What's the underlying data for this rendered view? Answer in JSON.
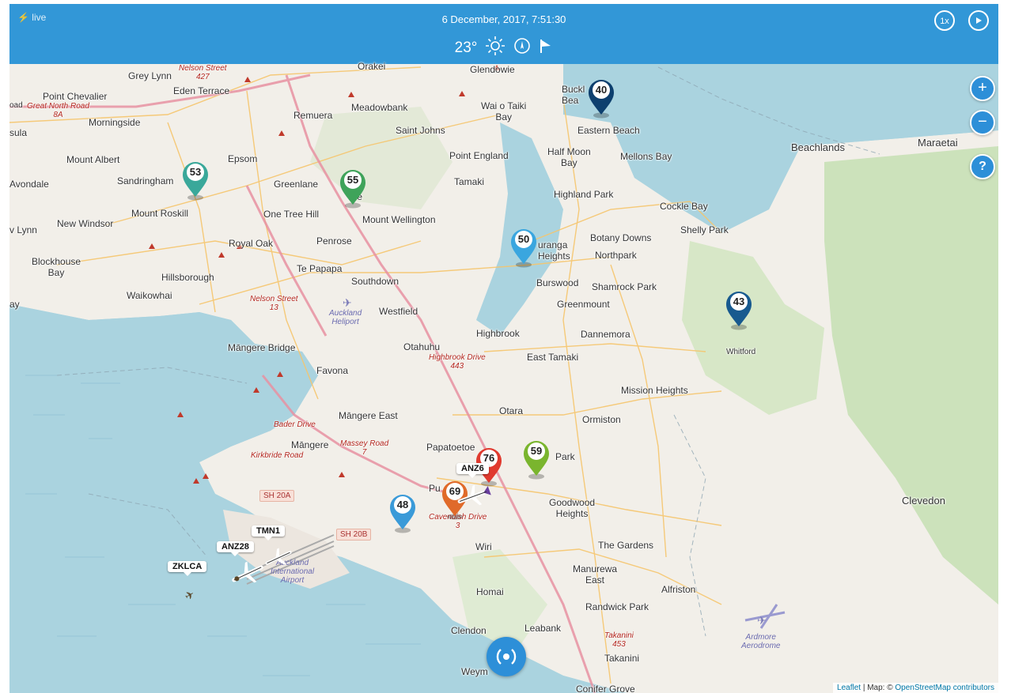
{
  "topbar": {
    "live": "⚡ live",
    "datetime": "6 December, 2017, 7:51:30",
    "temperature": "23°",
    "weather_icon": "sun-icon",
    "speed_label": "1x",
    "play_icon": "play-icon"
  },
  "zoom": {
    "in": "+",
    "out": "−",
    "help": "?"
  },
  "places": {
    "grey_lynn": "Grey Lynn",
    "eden_terrace": "Eden Terrace",
    "point_chevalier": "Point Chevalier",
    "morningside": "Morningside",
    "mount_albert": "Mount Albert",
    "avondale": "Avondale",
    "sandringham": "Sandringham",
    "epsom": "Epsom",
    "remuera": "Remuera",
    "meadowbank": "Meadowbank",
    "greenlane": "Greenlane",
    "ellerslie": "E         e",
    "mount_roskill": "Mount Roskill",
    "one_tree_hill": "One Tree Hill",
    "mount_wellington": "Mount Wellington",
    "new_windsor": "New Windsor",
    "lynn": "v Lynn",
    "royal_oak": "Royal Oak",
    "penrose": "Penrose",
    "blockhouse_bay": "Blockhouse\nBay",
    "te_papapa": "Te Papapa",
    "hillsborough": "Hillsborough",
    "southdown": "Southdown",
    "waikowhai": "Waikowhai",
    "westfield": "Westfield",
    "mangere_bridge": "Māngere Bridge",
    "otahuhu": "Otahuhu",
    "favona": "Favona",
    "mangere_east": "Māngere East",
    "mangere": "Māngere",
    "papatoetoe": "Papatoetoe",
    "pu": "Pu",
    "wiri": "Wiri",
    "homai": "Homai",
    "clendon": "Clendon",
    "leabank": "Leabank",
    "weymouth": "Weym",
    "takanini": "Takanini",
    "conifer_grove": "Conifer Grove",
    "manurewa_east": "Manurewa\nEast",
    "randwick_park": "Randwick Park",
    "alfriston": "Alfriston",
    "the_gardens": "The Gardens",
    "goodwood_heights": "Goodwood\nHeights",
    "park": "Park",
    "ormiston": "Ormiston",
    "otara": "Otara",
    "east_tamaki": "East Tamaki",
    "highbrook": "Highbrook",
    "dannemora": "Dannemora",
    "mission_heights": "Mission Heights",
    "greenmount": "Greenmount",
    "burswood": "Burswood",
    "shamrock_park": "Shamrock Park",
    "northpark": "Northpark",
    "botany_downs": "Botany Downs",
    "pakuranga_heights": "uranga\nHeights",
    "highland_park": "Highland Park",
    "cockle_bay": "Cockle Bay",
    "shelly_park": "Shelly Park",
    "half_moon_bay": "Half Moon\nBay",
    "mellons_bay": "Mellons Bay",
    "eastern_beach": "Eastern Beach",
    "bucklands_beach": "Buckl\nBea",
    "glendowie": "Glendowie",
    "wai_o_taiki_bay": "Wai o Taiki\nBay",
    "saint_johns": "Saint Johns",
    "point_england": "Point England",
    "tamaki": "Tamaki",
    "beachlands": "Beachlands",
    "maraetai": "Maraetai",
    "whitford": "Whitford",
    "clevedon": "Clevedon",
    "orakei": "Orakei",
    "sula": "sula",
    "ay": "ay",
    "oad": "oad"
  },
  "roads": {
    "great_north_road": "Great North Road\n8A",
    "nelson_street_top": "Nelson Street\n427",
    "nelson_street": "Nelson Street\n13",
    "highbrook_drive": "Highbrook Drive\n443",
    "bader_drive": "Bader Drive",
    "massey_road": "Massey Road\n7",
    "kirkbride_road": "Kirkbride Road",
    "cavendish_drive": "Cavendish Drive\n3",
    "takanini_453": "Takanini\n453",
    "sh20a": "SH 20A",
    "sh20b": "SH 20B"
  },
  "airports": {
    "auckland_heliport": "Auckland\nHeliport",
    "auckland_airport": "Auckland\nInternational\nAirport",
    "ardmore": "Ardmore\nAerodrome"
  },
  "markers": [
    {
      "id": "m40",
      "value": "40",
      "color": "#0d3f6e"
    },
    {
      "id": "m53",
      "value": "53",
      "color": "#3aa89a"
    },
    {
      "id": "m55",
      "value": "55",
      "color": "#3fa35a"
    },
    {
      "id": "m50",
      "value": "50",
      "color": "#3aa6df"
    },
    {
      "id": "m43",
      "value": "43",
      "color": "#185a8f"
    },
    {
      "id": "m76",
      "value": "76",
      "color": "#e03a2f"
    },
    {
      "id": "m59",
      "value": "59",
      "color": "#7ab52e"
    },
    {
      "id": "m69",
      "value": "69",
      "color": "#e06a2a"
    },
    {
      "id": "m48",
      "value": "48",
      "color": "#3a9ad8"
    }
  ],
  "flights": {
    "anz6": "ANZ6",
    "tmn1": "TMN1",
    "anz28": "ANZ28",
    "zklca": "ZKLCA"
  },
  "playback_icon": "record-icon",
  "attribution": {
    "leaflet": "Leaflet",
    "map": " | Map: © ",
    "osm": "OpenStreetMap contributors"
  }
}
